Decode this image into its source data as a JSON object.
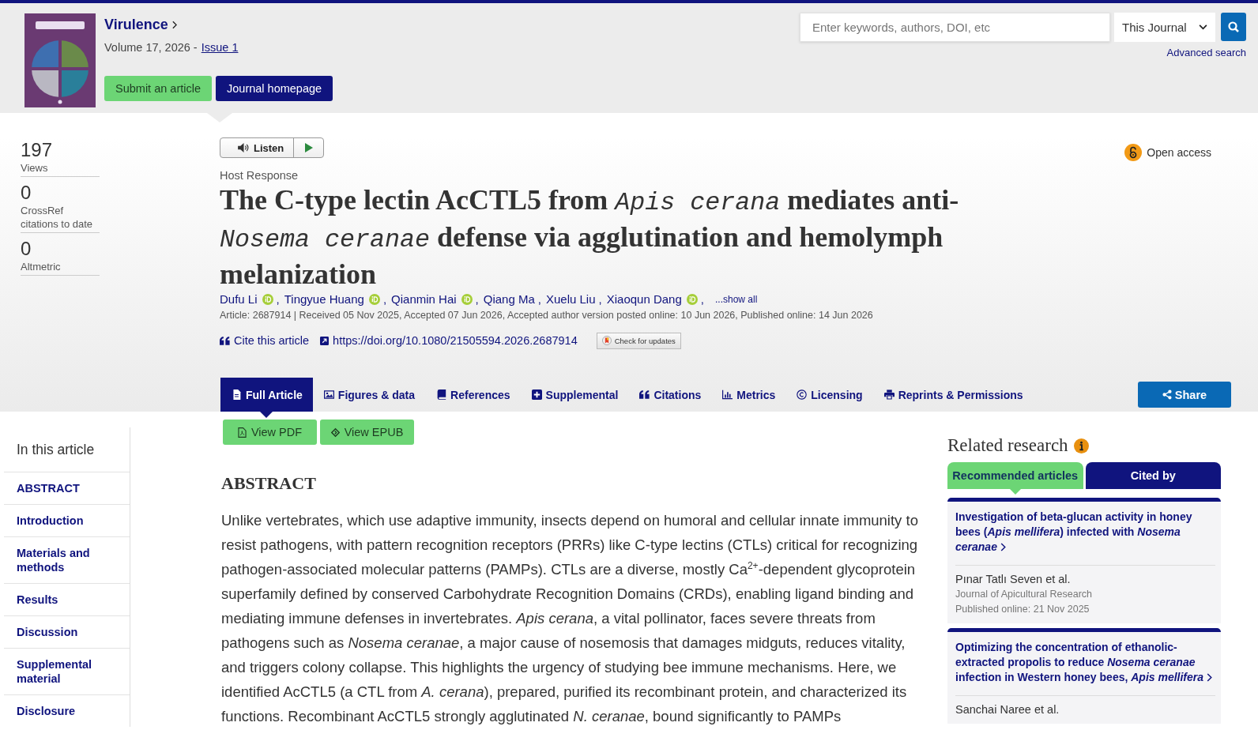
{
  "header": {
    "journal": "Virulence",
    "volume": "Volume 17, 2026 -",
    "issue": "Issue 1",
    "buttons": [
      {
        "label": "Submit an article",
        "kind": "accent"
      },
      {
        "label": "Journal homepage",
        "kind": "solid"
      }
    ]
  },
  "search": {
    "placeholder": "Enter keywords, authors, DOI, etc",
    "scope": "This Journal",
    "advanced": "Advanced search"
  },
  "metrics": [
    {
      "value": "197",
      "label": "Views"
    },
    {
      "value": "0",
      "label": "CrossRef citations to date"
    },
    {
      "value": "0",
      "label": "Altmetric"
    }
  ],
  "article": {
    "listen": "Listen",
    "access": "Open access",
    "category": "Host Response",
    "title": "The C-type lectin AcCTL5 from *Apis cerana* mediates anti-*Nosema ceranae* defense via agglutination and hemolymph melanization",
    "authors": [
      {
        "name": "Dufu Li",
        "orcid": true,
        "sep": ","
      },
      {
        "name": "Tingyue Huang",
        "orcid": true,
        "sep": ","
      },
      {
        "name": "Qianmin Hai",
        "orcid": true,
        "sep": ","
      },
      {
        "name": "Qiang Ma",
        "orcid": false,
        "sep": ","
      },
      {
        "name": "Xuelu Liu",
        "orcid": false,
        "sep": ","
      },
      {
        "name": "Xiaoqun Dang",
        "orcid": true,
        "sep": ","
      }
    ],
    "show_all": "...show all",
    "info": "Article: 2687914 | Received 05 Nov 2025, Accepted 07 Jun 2026, Accepted author version posted online: 10 Jun 2026, Published online: 14 Jun 2026",
    "cite": "Cite this article",
    "doi": "https://doi.org/10.1080/21505594.2026.2687914",
    "updates": "Check for updates"
  },
  "tabs": [
    {
      "label": "Full Article",
      "selected": true
    },
    {
      "label": "Figures & data",
      "selected": false
    },
    {
      "label": "References",
      "selected": false
    },
    {
      "label": "Supplemental",
      "selected": false
    },
    {
      "label": "Citations",
      "selected": false
    },
    {
      "label": "Metrics",
      "selected": false
    },
    {
      "label": "Licensing",
      "selected": false
    },
    {
      "label": "Reprints & Permissions",
      "selected": false
    }
  ],
  "share": "Share",
  "view_buttons": [
    "View PDF",
    "View EPUB"
  ],
  "outline": {
    "heading": "In this article",
    "items": [
      "ABSTRACT",
      "Introduction",
      "Materials and methods",
      "Results",
      "Discussion",
      "Supplemental material",
      "Disclosure"
    ]
  },
  "abstract": {
    "heading": "ABSTRACT",
    "text": "Unlike vertebrates, which use adaptive immunity, insects depend on humoral and cellular innate immunity to resist pathogens, with pattern recognition receptors (PRRs) like C-type lectins (CTLs) critical for recognizing pathogen-associated molecular patterns (PAMPs). CTLs are a diverse, mostly Ca$^{2+}$-dependent glycoprotein superfamily defined by conserved Carbohydrate Recognition Domains (CRDs), enabling ligand binding and mediating immune defenses in invertebrates. *Apis cerana*, a vital pollinator, faces severe threats from pathogens such as *Nosema ceranae*, a major cause of nosemosis that damages midguts, reduces vitality, and triggers colony collapse. This highlights the urgency of studying bee immune mechanisms. Here, we identified AcCTL5 (a CTL from *A. cerana*), prepared, purified its recombinant protein, and characterized its functions. Recombinant AcCTL5 strongly agglutinated *N. ceranae*, bound significantly to PAMPs"
  },
  "related": {
    "heading": "Related research",
    "tabs": [
      {
        "label": "Recommended articles",
        "selected": true
      },
      {
        "label": "Cited by",
        "selected": false
      }
    ],
    "articles": [
      {
        "title": "Investigation of beta-glucan activity in honey bees (*Apis mellifera*) infected with *Nosema ceranae*",
        "authors": "Pınar Tatlı Seven et al.",
        "journal": "Journal of Apicultural Research",
        "published": "Published online: 21 Nov 2025"
      },
      {
        "title": "Optimizing the concentration of ethanolic-extracted propolis to reduce *Nosema ceranae* infection in Western honey bees, *Apis mellifera*",
        "authors": "Sanchai Naree et al."
      }
    ]
  }
}
